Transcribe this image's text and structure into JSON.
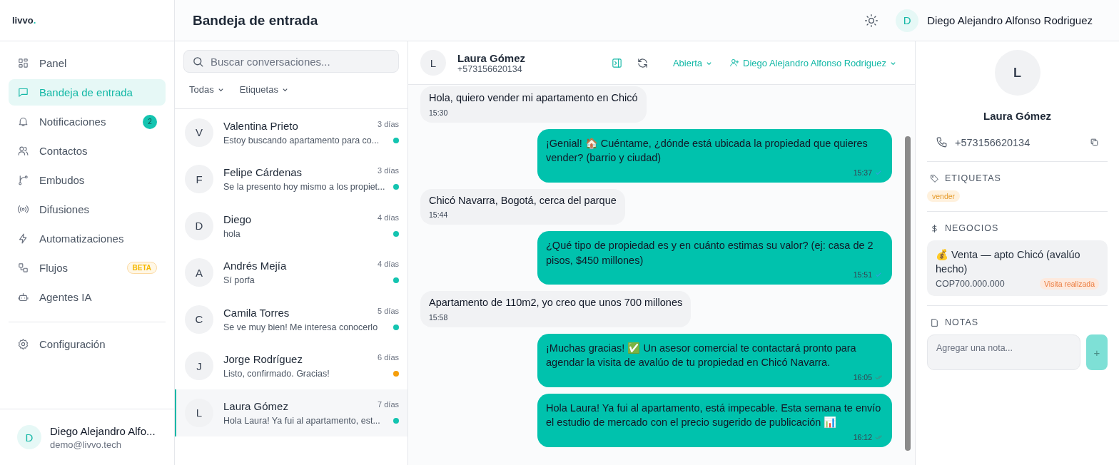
{
  "brand": {
    "name": "livvo",
    "dot": "."
  },
  "sidebar": {
    "items": [
      {
        "label": "Panel",
        "selected": false
      },
      {
        "label": "Bandeja de entrada",
        "selected": true
      },
      {
        "label": "Notificaciones",
        "selected": false,
        "badge": {
          "kind": "count",
          "text": "2"
        }
      },
      {
        "label": "Contactos",
        "selected": false
      },
      {
        "label": "Embudos",
        "selected": false
      },
      {
        "label": "Difusiones",
        "selected": false
      },
      {
        "label": "Automatizaciones",
        "selected": false
      },
      {
        "label": "Flujos",
        "selected": false,
        "badge": {
          "kind": "beta",
          "text": "BETA"
        }
      },
      {
        "label": "Agentes IA",
        "selected": false
      }
    ],
    "settings": {
      "label": "Configuración",
      "selected": false
    },
    "user": {
      "initial": "D",
      "name": "Diego Alejandro Alfo...",
      "email": "demo@livvo.tech"
    }
  },
  "header": {
    "title": "Bandeja de entrada",
    "user": {
      "initial": "D",
      "name": "Diego Alejandro Alfonso Rodriguez"
    }
  },
  "conversations": {
    "search": {
      "placeholder": "Buscar conversaciones..."
    },
    "filters": [
      "Todas",
      "Etiquetas"
    ],
    "items": [
      {
        "initial": "V",
        "name": "Valentina Prieto",
        "time": "3 días",
        "preview": "Estoy buscando apartamento para co...",
        "color": "#14c4b0",
        "selected": false
      },
      {
        "initial": "F",
        "name": "Felipe Cárdenas",
        "time": "3 días",
        "preview": "Se la presento hoy mismo a los propiet...",
        "color": "#14c4b0",
        "selected": false
      },
      {
        "initial": "D",
        "name": "Diego",
        "time": "4 días",
        "preview": "hola",
        "color": "#14c4b0",
        "selected": false
      },
      {
        "initial": "A",
        "name": "Andrés Mejía",
        "time": "4 días",
        "preview": "Sí porfa",
        "color": "#14c4b0",
        "selected": false
      },
      {
        "initial": "C",
        "name": "Camila Torres",
        "time": "5 días",
        "preview": "Se ve muy bien! Me interesa conocerlo",
        "color": "#14c4b0",
        "selected": false
      },
      {
        "initial": "J",
        "name": "Jorge Rodríguez",
        "time": "6 días",
        "preview": "Listo, confirmado. Gracias!",
        "color": "#f59e0b",
        "selected": false
      },
      {
        "initial": "L",
        "name": "Laura Gómez",
        "time": "7 días",
        "preview": "Hola Laura! Ya fui al apartamento, est...",
        "color": "#14c4b0",
        "selected": true
      }
    ]
  },
  "chat": {
    "contact": {
      "initial": "L",
      "name": "Laura Gómez",
      "phone": "+573156620134"
    },
    "status": "Abierta",
    "assignee": "Diego Alejandro Alfonso Rodriguez",
    "messages": [
      {
        "kind": "in",
        "text": "Hola, quiero vender mi apartamento en Chicó",
        "time": "15:30"
      },
      {
        "kind": "out",
        "text": "¡Genial! 🏠 Cuéntame, ¿dónde está ubicada la propiedad que quieres vender? (barrio y ciudad)",
        "time": "15:37",
        "read": true
      },
      {
        "kind": "in",
        "text": "Chicó Navarra, Bogotá, cerca del parque",
        "time": "15:44"
      },
      {
        "kind": "out",
        "text": "¿Qué tipo de propiedad es y en cuánto estimas su valor? (ej: casa de 2 pisos, $450 millones)",
        "time": "15:51",
        "read": true
      },
      {
        "kind": "in",
        "text": "Apartamento de 110m2, yo creo que unos 700 millones",
        "time": "15:58"
      },
      {
        "kind": "out",
        "text": "¡Muchas gracias! ✅ Un asesor comercial te contactará pronto para agendar la visita de avalúo de tu propiedad en Chicó Navarra.",
        "time": "16:05",
        "read": false
      },
      {
        "kind": "out",
        "text": "Hola Laura! Ya fui al apartamento, está impecable. Esta semana te envío el estudio de mercado con el precio sugerido de publicación 📊",
        "time": "16:12",
        "read": false
      }
    ]
  },
  "details": {
    "initial": "L",
    "name": "Laura Gómez",
    "phone": "+573156620134",
    "tags_title": "ETIQUETAS",
    "tags": [
      "vender"
    ],
    "deals_title": "NEGOCIOS",
    "deals": [
      {
        "title": "💰 Venta — apto Chicó (avalúo hecho)",
        "amount": "COP700.000.000",
        "stage": "Visita realizada"
      }
    ],
    "notes_title": "NOTAS",
    "note_placeholder": "Agregar una nota...",
    "add": "+"
  }
}
